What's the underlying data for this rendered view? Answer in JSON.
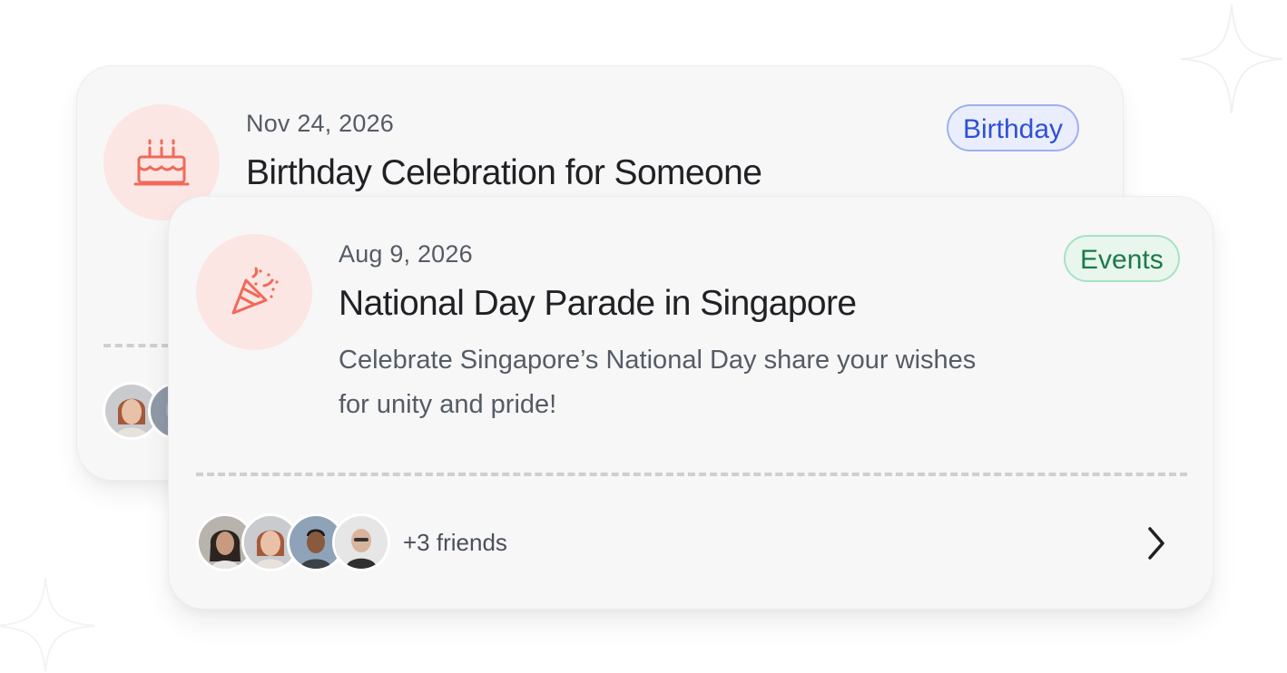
{
  "cards": [
    {
      "date": "Nov 24, 2026",
      "title": "Birthday Celebration for Someone",
      "tag": "Birthday",
      "icon": "birthday-cake-icon"
    },
    {
      "date": "Aug 9, 2026",
      "title": "National Day Parade in Singapore",
      "description": "Celebrate Singapore’s National Day share your wishes for unity and pride!",
      "tag": "Events",
      "icon": "party-popper-icon",
      "friends_label": "+3 friends"
    }
  ],
  "colors": {
    "card_background": "#f7f7f7",
    "icon_background": "#fbe6e3",
    "icon_accent": "#f0695a",
    "birthday_tag": "#2f50d6",
    "events_tag": "#1c7a47"
  }
}
